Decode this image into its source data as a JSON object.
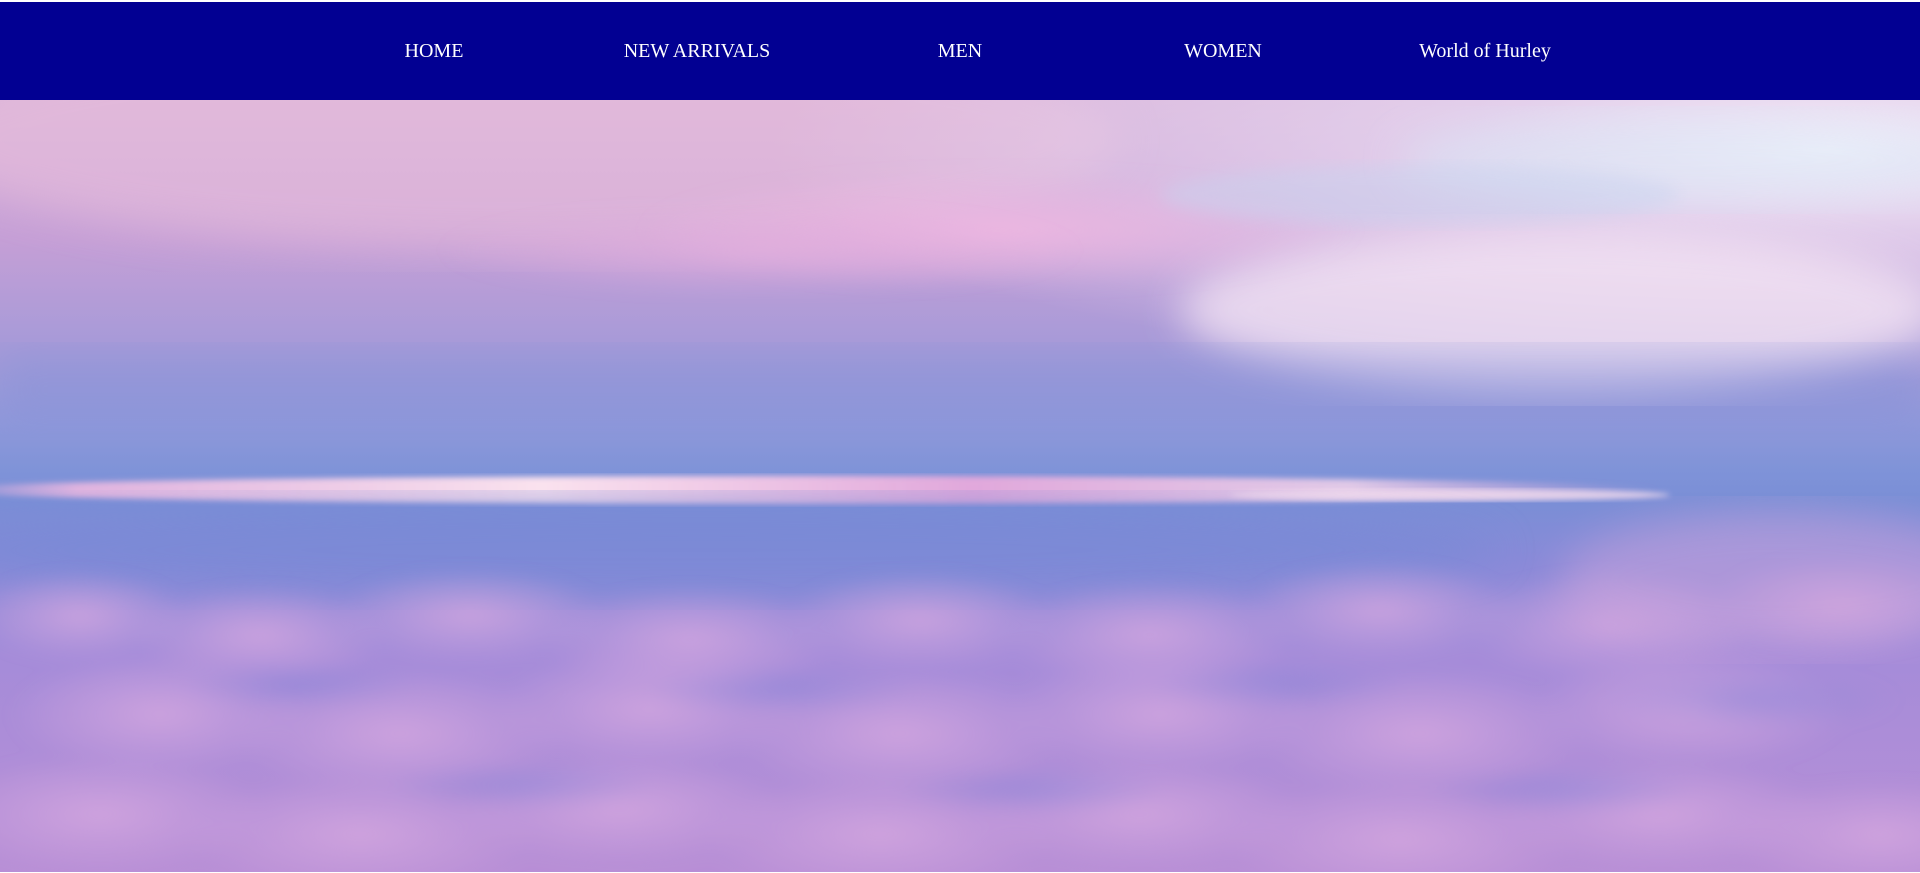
{
  "nav": {
    "items": [
      {
        "label": "HOME"
      },
      {
        "label": "NEW ARRIVALS"
      },
      {
        "label": "MEN"
      },
      {
        "label": "WOMEN"
      },
      {
        "label": "World of Hurley"
      }
    ]
  },
  "hero": {
    "image": "sky-above-clouds-sunset"
  },
  "colors": {
    "nav_background": "#020092",
    "nav_text": "#ffffff",
    "sky_upper": "#c9a6d8",
    "sky_blue": "#7e8ad6",
    "cloud_pink": "#b98fd8"
  }
}
